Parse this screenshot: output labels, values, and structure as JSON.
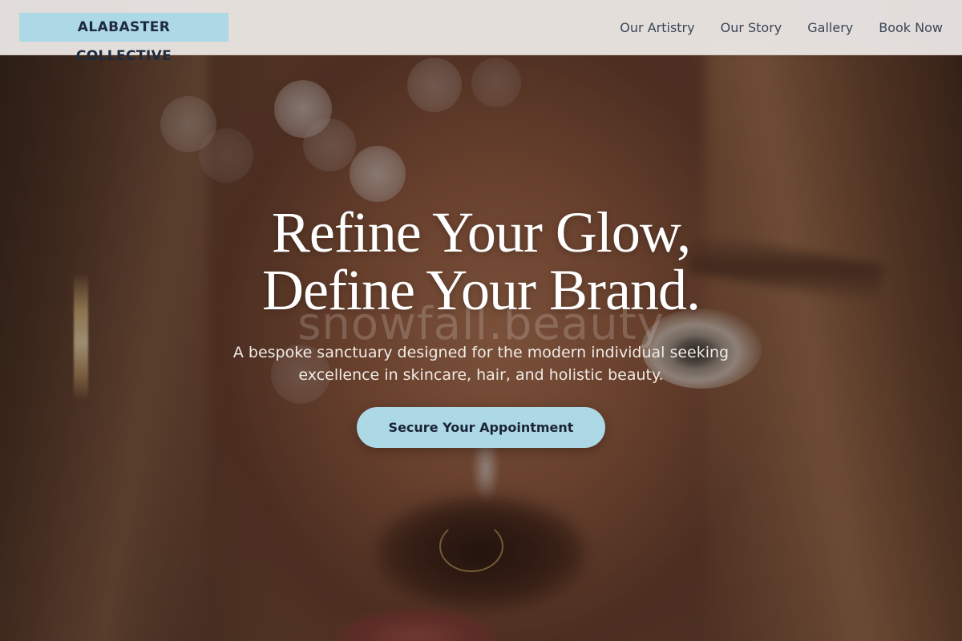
{
  "header": {
    "logo": "ALABASTER COLLECTIVE",
    "nav": [
      {
        "label": "Our Artistry"
      },
      {
        "label": "Our Story"
      },
      {
        "label": "Gallery"
      },
      {
        "label": "Book Now"
      }
    ]
  },
  "hero": {
    "title_line1": "Refine Your Glow,",
    "title_line2": "Define Your Brand.",
    "subtitle": "A bespoke sanctuary designed for the modern individual seeking excellence in skincare, hair, and holistic beauty.",
    "cta_label": "Secure Your Appointment",
    "watermark": "snowfall.beauty"
  },
  "colors": {
    "accent": "#add8e6",
    "logo_text": "#1e2a3e",
    "nav_text": "#3a4556",
    "hero_text": "#ffffff"
  }
}
